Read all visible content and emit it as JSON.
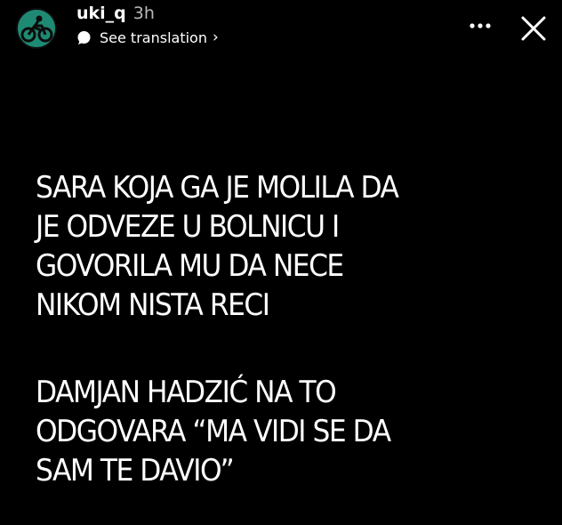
{
  "header": {
    "username": "uki_q",
    "timestamp": "3h",
    "translation_label": "See translation",
    "translation_chevron": "›",
    "avatar_icon": "cyclist-avatar-icon",
    "more_icon": "more-dots-icon",
    "close_icon": "close-icon"
  },
  "story": {
    "paragraph1": [
      "SARA KOJA GA JE MOLILA DA",
      "JE ODVEZE U BOLNICU I",
      "GOVORILA MU DA NECE",
      "NIKOM NISTA RECI"
    ],
    "paragraph2": [
      "DAMJAN HADZIĆ NA TO",
      "ODGOVARA “MA VIDI SE DA",
      "SAM TE DAVIO”"
    ]
  },
  "colors": {
    "background": "#000000",
    "text": "#ffffff",
    "muted_text": "#b9b9b9",
    "avatar_bg": "#1f8a73"
  }
}
